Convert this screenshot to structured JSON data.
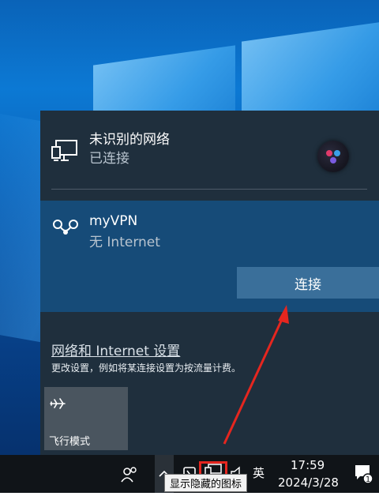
{
  "networks": [
    {
      "name": "未识别的网络",
      "status": "已连接",
      "icon": "wired-network-icon"
    },
    {
      "name": "myVPN",
      "status": "无 Internet",
      "icon": "vpn-icon",
      "action_label": "连接"
    }
  ],
  "settings": {
    "link": "网络和 Internet 设置",
    "description": "更改设置，例如将某连接设置为按流量计费。"
  },
  "quick_actions": [
    {
      "label": "飞行模式",
      "icon": "airplane-icon"
    }
  ],
  "taskbar": {
    "ime": "英",
    "time": "17:59",
    "date": "2024/3/28",
    "notification_count": "1",
    "tooltip": "显示隐藏的图标"
  },
  "colors": {
    "flyout_bg": "#1f2f3d",
    "selected_network_bg": "#164b78",
    "connect_button": "#3a6f9a",
    "highlight_red": "#e5261f"
  }
}
